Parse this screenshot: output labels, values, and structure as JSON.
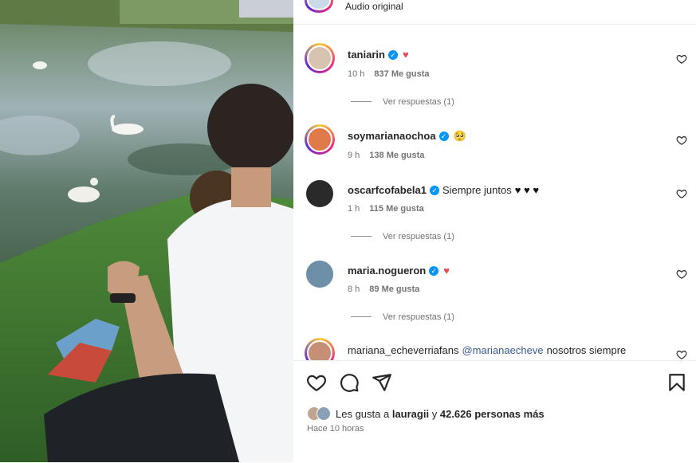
{
  "header": {
    "audio_label": "Audio original"
  },
  "comments": [
    {
      "user": "taniarin",
      "text": "",
      "emoji": "♥",
      "time": "10 h",
      "likes": "837 Me gusta",
      "replies": "Ver respuestas (1)"
    },
    {
      "user": "soymarianaochoa",
      "text": "",
      "emoji": "🥺",
      "time": "9 h",
      "likes": "138 Me gusta",
      "replies": ""
    },
    {
      "user": "oscarfcofabela1",
      "text": "Siempre juntos",
      "emoji": "♥ ♥ ♥",
      "time": "1 h",
      "likes": "115 Me gusta",
      "replies": "Ver respuestas (1)"
    },
    {
      "user": "maria.nogueron",
      "text": "",
      "emoji": "♥",
      "time": "8 h",
      "likes": "89 Me gusta",
      "replies": "Ver respuestas (1)"
    },
    {
      "user": "mariana_echeverriafans",
      "mention": "@marianaecheve",
      "text": "nosotros siempre"
    }
  ],
  "likes_summary": {
    "prefix": "Les gusta a",
    "user": "lauragii",
    "joiner": "y",
    "count": "42.626 personas más"
  },
  "posted": "Hace 10 horas",
  "icons": {
    "like": "heart-outline-icon",
    "comment": "comment-bubble-icon",
    "share": "paper-plane-icon",
    "save": "bookmark-icon",
    "verified": "verified-badge-icon"
  },
  "colors": {
    "verified": "#0095f6",
    "red_heart": "#ed4956",
    "muted": "#737373"
  }
}
